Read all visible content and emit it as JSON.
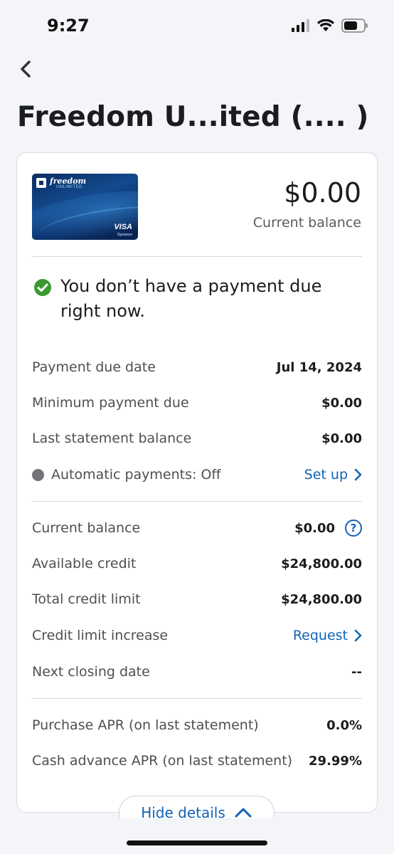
{
  "status_bar": {
    "time": "9:27"
  },
  "page": {
    "title": "Freedom U...ited (....        )"
  },
  "card": {
    "brand": "freedom",
    "sub_brand": "UNLIMITED",
    "network": "VISA",
    "network_sub": "Signature",
    "balance_amount": "$0.00",
    "balance_label": "Current balance"
  },
  "notice": {
    "text": "You don’t have a payment due right now."
  },
  "payment_rows": [
    {
      "label": "Payment due date",
      "value": "Jul 14, 2024"
    },
    {
      "label": "Minimum payment due",
      "value": "$0.00"
    },
    {
      "label": "Last statement balance",
      "value": "$0.00"
    }
  ],
  "autopay": {
    "label": "Automatic payments: Off",
    "link": "Set up"
  },
  "account_rows": {
    "current_balance": {
      "label": "Current balance",
      "value": "$0.00",
      "help_icon": "?"
    },
    "available_credit": {
      "label": "Available credit",
      "value": "$24,800.00"
    },
    "total_credit_limit": {
      "label": "Total credit limit",
      "value": "$24,800.00"
    },
    "credit_limit_increase": {
      "label": "Credit limit increase",
      "link": "Request"
    },
    "next_closing_date": {
      "label": "Next closing date",
      "value": "--"
    }
  },
  "apr_rows": [
    {
      "label": "Purchase APR (on last statement)",
      "value": "0.0%"
    },
    {
      "label": "Cash advance APR (on last statement)",
      "value": "29.99%"
    }
  ],
  "footer": {
    "hide_details_label": "Hide details"
  },
  "colors": {
    "accent_blue": "#1163b5",
    "success_green": "#3a9a30",
    "background": "#f3f5f8",
    "card_blue": "#0c336d"
  },
  "icons": {
    "back": "chevron-left-icon",
    "signal": "signal-icon",
    "wifi": "wifi-icon",
    "battery": "battery-icon",
    "success": "check-circle-icon",
    "chevron_right": "chevron-right-icon",
    "help": "help-circle-icon",
    "chevron_up": "chevron-up-icon"
  }
}
